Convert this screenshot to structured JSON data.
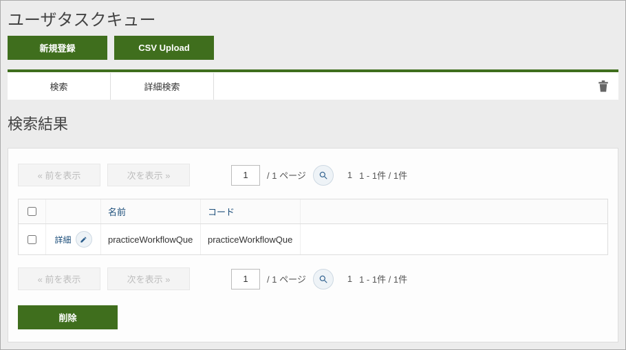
{
  "title": "ユーザタスクキュー",
  "toolbar": {
    "new_label": "新規登録",
    "csv_label": "CSV Upload"
  },
  "tabs": {
    "search": "検索",
    "advanced": "詳細検索"
  },
  "icons": {
    "trash": "trash-icon"
  },
  "section_title": "検索結果",
  "paginator": {
    "prev_label": "«  前を表示",
    "next_label": "次を表示  »",
    "page_value": "1",
    "page_total_prefix": "/  ",
    "page_total_text": "1 ページ",
    "count_index": "1",
    "count_range": "1 - 1件 / 1件"
  },
  "table": {
    "columns": {
      "name": "名前",
      "code": "コード"
    },
    "rows": [
      {
        "detail_label": "詳細",
        "name": "practiceWorkflowQue",
        "code": "practiceWorkflowQue"
      }
    ]
  },
  "actions": {
    "delete_label": "削除"
  }
}
